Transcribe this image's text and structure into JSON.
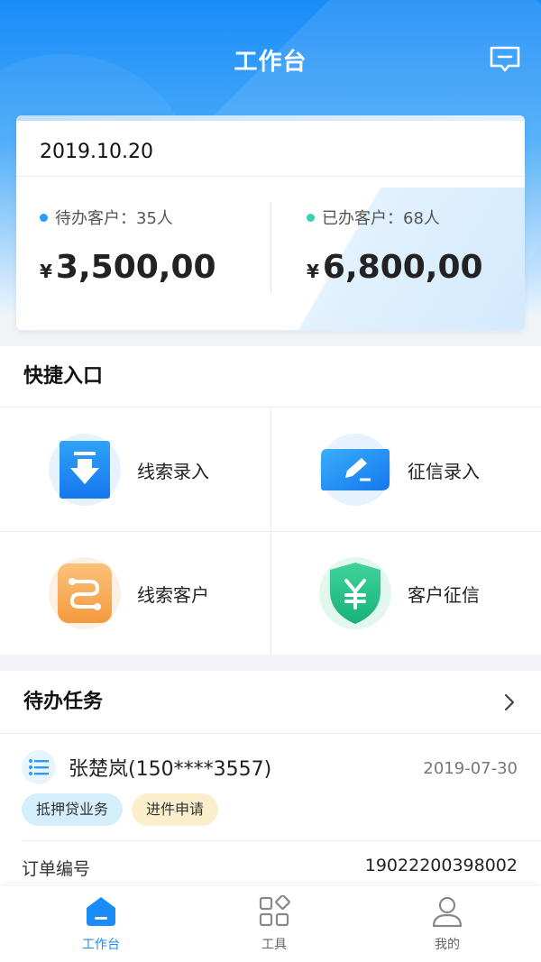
{
  "header": {
    "title": "工作台",
    "message_icon": "message-icon"
  },
  "summary": {
    "date": "2019.10.20",
    "pending": {
      "label": "待办客户：35人",
      "currency": "¥",
      "amount": "3,500,00",
      "dot_color": "#2a9df4"
    },
    "done": {
      "label": "已办客户：68人",
      "currency": "¥",
      "amount": "6,800,00",
      "dot_color": "#3ccfb4"
    }
  },
  "quick_entry": {
    "title": "快捷入口",
    "items": [
      {
        "label": "线索录入",
        "icon": "download-doc-icon"
      },
      {
        "label": "征信录入",
        "icon": "edit-pen-icon"
      },
      {
        "label": "线索客户",
        "icon": "link-customer-icon"
      },
      {
        "label": "客户征信",
        "icon": "yuan-shield-icon"
      }
    ]
  },
  "todo": {
    "title": "待办任务",
    "task": {
      "name": "张楚岚(150****3557)",
      "date": "2019-07-30",
      "tags": [
        "抵押贷业务",
        "进件申请"
      ],
      "order_label": "订单编号",
      "order_value": "19022200398002"
    }
  },
  "tabbar": {
    "active_color": "#1a8cf8",
    "items": [
      {
        "label": "工作台",
        "icon": "home-icon",
        "active": true
      },
      {
        "label": "工具",
        "icon": "grid-tools-icon",
        "active": false
      },
      {
        "label": "我的",
        "icon": "user-icon",
        "active": false
      }
    ]
  }
}
